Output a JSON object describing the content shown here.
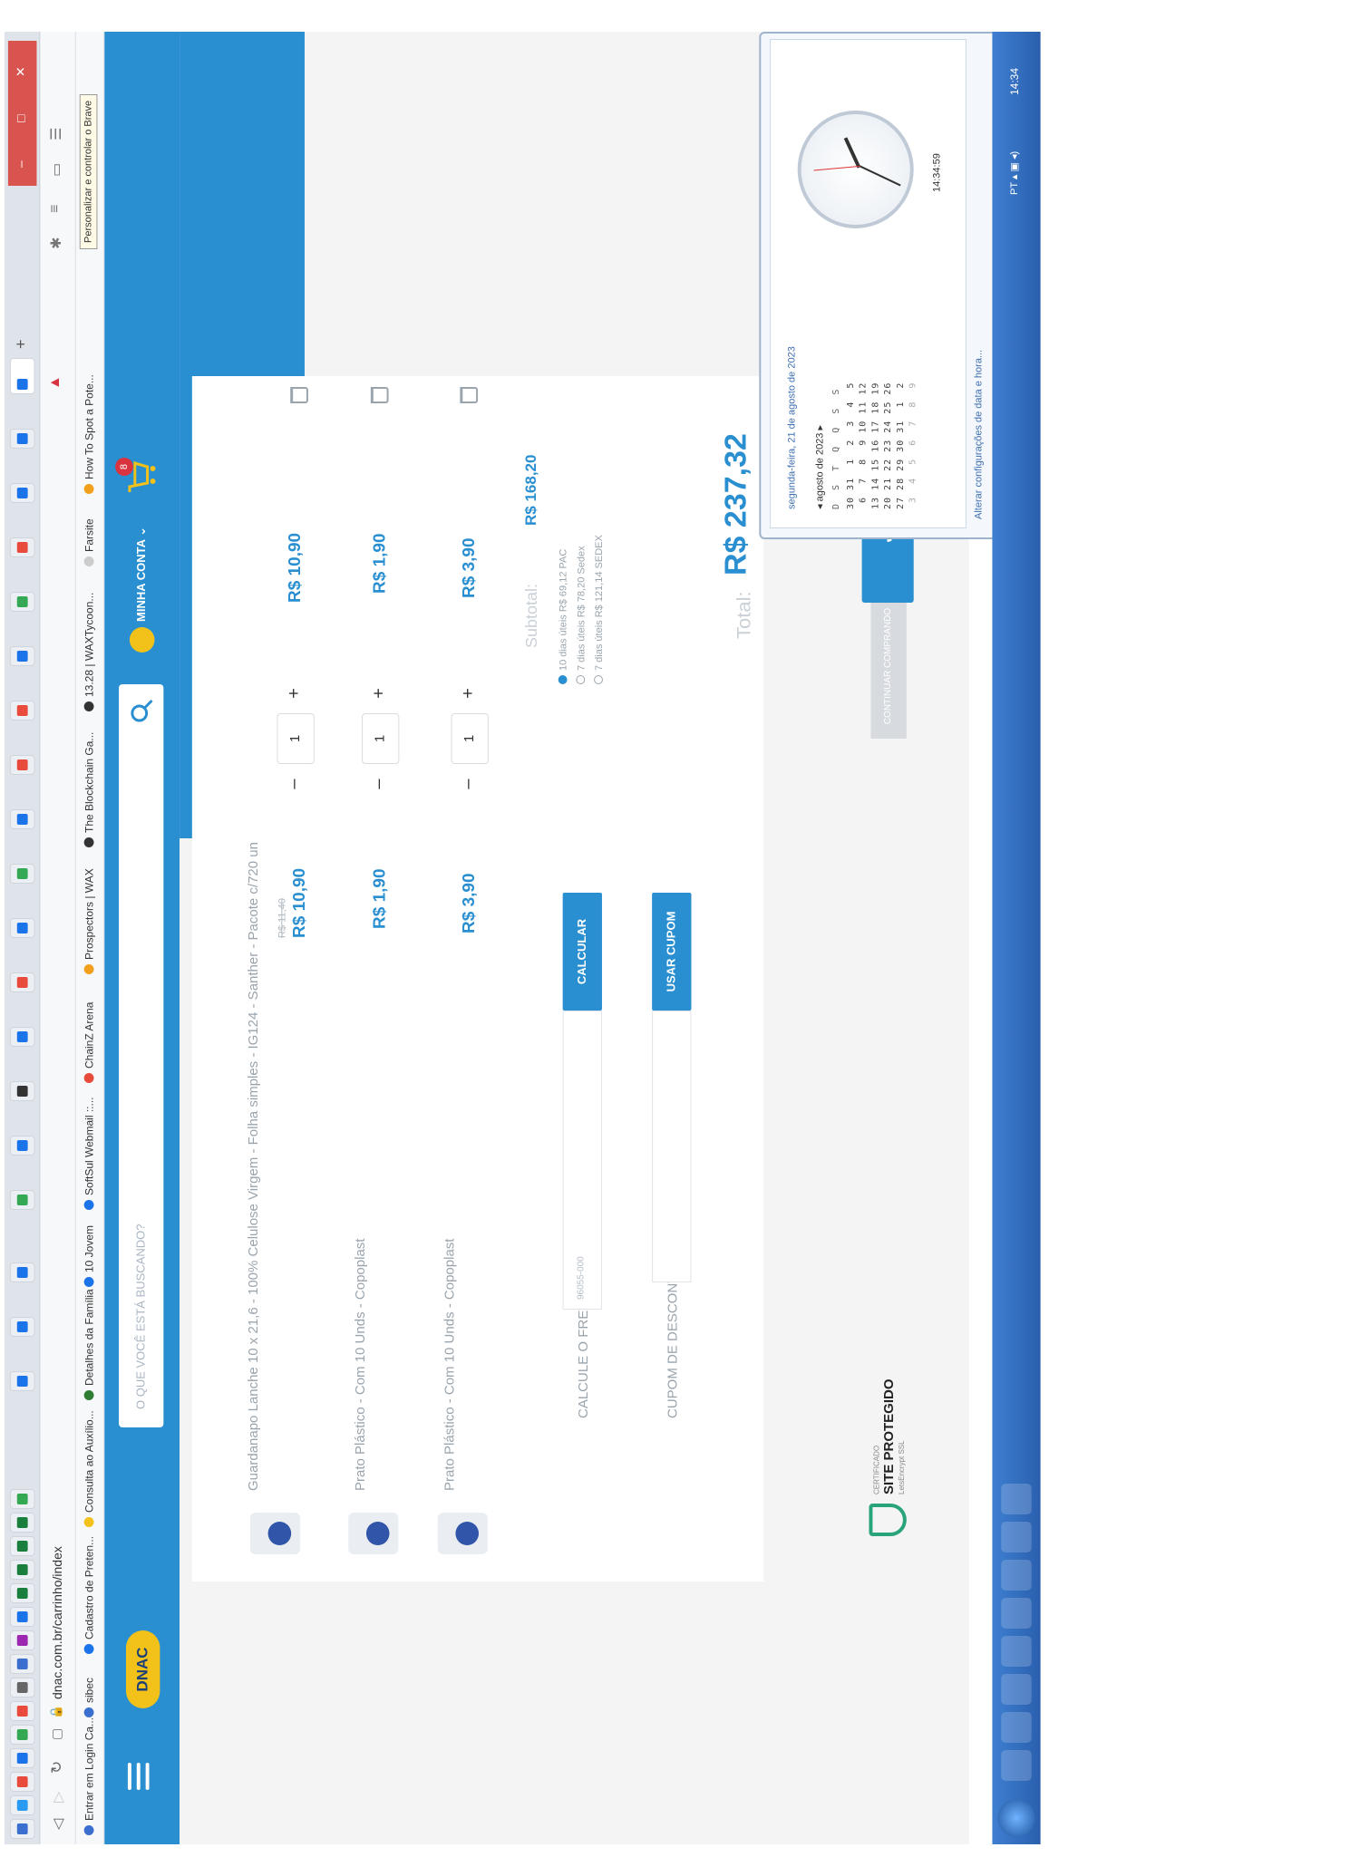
{
  "browser": {
    "url": "dnac.com.br/carrinho/index",
    "tooltip": "Personalizar e controlar o Brave",
    "bookmarks": [
      {
        "label": "Entrar em Login Ca..."
      },
      {
        "label": "sibec"
      },
      {
        "label": "Cadastro de Preten..."
      },
      {
        "label": "Consulta ao Auxílio..."
      },
      {
        "label": "Detalhes da Família"
      },
      {
        "label": "10 Jovem"
      },
      {
        "label": "SoftSul Webmail ::..."
      },
      {
        "label": "ChainZ Arena"
      },
      {
        "label": "Prospectors | WAX"
      },
      {
        "label": "The Blockchain Ga..."
      },
      {
        "label": "13.28 | WAXTycoon..."
      },
      {
        "label": "Farsite"
      },
      {
        "label": "How To Spot a Pote..."
      }
    ]
  },
  "header": {
    "logo": "DNAC",
    "search_placeholder": "O QUE VOCÊ ESTÁ BUSCANDO?",
    "account": "MINHA CONTA",
    "cart_count": "8"
  },
  "cart": {
    "items": [
      {
        "name": "Guardanapo Lanche 10 x 21,6 - 100% Celulose Virgem - Folha simples - IG124 - Santher - Pacote c/720 un",
        "old_price": "R$ 11,40",
        "price": "R$ 10,90",
        "qty": "1",
        "total": "R$ 10,90"
      },
      {
        "name": "Prato Plástico - Com 10 Unds - Copoplast",
        "old_price": "",
        "price": "R$ 1,90",
        "qty": "1",
        "total": "R$ 1,90"
      },
      {
        "name": "Prato Plástico - Com 10 Unds - Copoplast",
        "old_price": "",
        "price": "R$ 3,90",
        "qty": "1",
        "total": "R$ 3,90"
      }
    ],
    "shipping_label": "CALCULE O FRETE:",
    "shipping_placeholder": "96055-000",
    "shipping_button": "CALCULAR",
    "coupon_label": "CUPOM DE DESCONTO:",
    "coupon_button": "USAR CUPOM",
    "shipping_options": [
      {
        "label": "10 dias úteis R$ 69,12 PAC"
      },
      {
        "label": "7 dias úteis R$ 78,20 Sedex"
      },
      {
        "label": "7 dias úteis R$ 121,14 SEDEX"
      }
    ],
    "subtotal_label": "Subtotal:",
    "subtotal_value": "R$ 168,20",
    "total_label": "Total:",
    "total_value": "R$ 237,32",
    "continue_button": "CONTINUAR COMPRANDO",
    "checkout_button": "✔ FINALIZAR COMPRA"
  },
  "seal": {
    "top": "CERTIFICADO",
    "main": "SITE PROTEGIDO",
    "bottom": "LetsEncrypt SSL"
  },
  "calendar": {
    "date_line": "segunda-feira, 21 de agosto de 2023",
    "month": "agosto de 2023",
    "weekdays": "D  S  T  Q  Q  S  S",
    "rows": [
      "30 31  1  2  3  4  5",
      " 6  7  8  9 10 11 12",
      "13 14 15 16 17 18 19",
      "20 21 22 23 24 25 26",
      "27 28 29 30 31  1  2",
      " 3  4  5  6  7  8  9"
    ],
    "time": "14:34:59",
    "link": "Alterar configurações de data e hora..."
  },
  "taskbar": {
    "lang": "PT",
    "clock": "14:34"
  }
}
